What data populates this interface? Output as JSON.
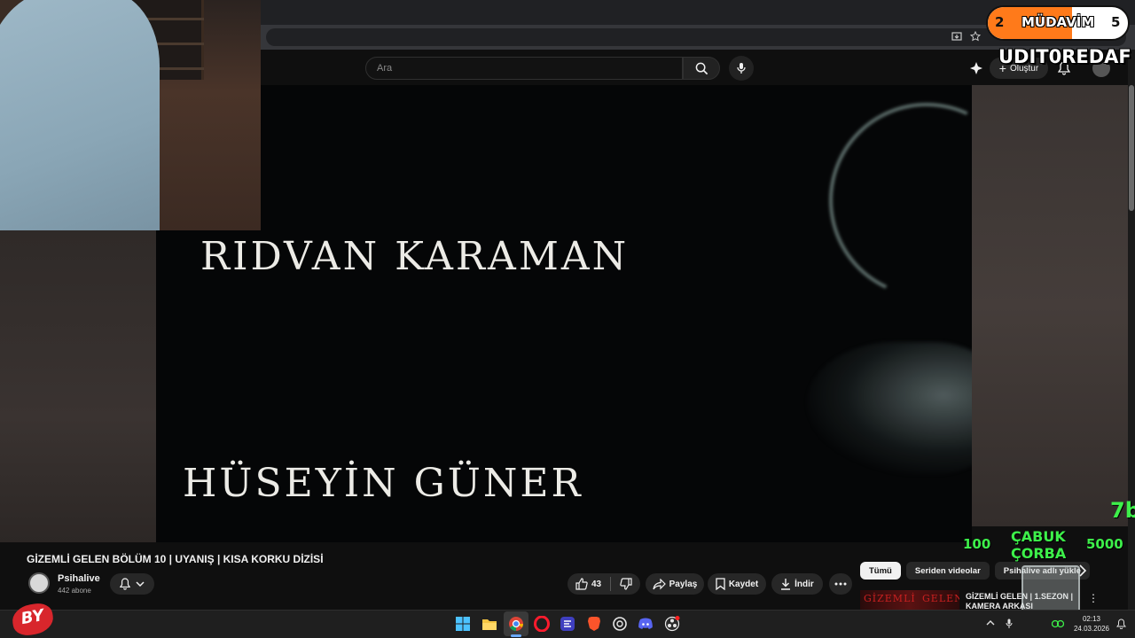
{
  "youtube": {
    "search_placeholder": "Ara",
    "create_label": "Oluştur"
  },
  "video": {
    "credit_line_1": "RIDVAN KARAMAN",
    "credit_line_2": "HÜSEYİN GÜNER"
  },
  "overlay": {
    "mudavim_left": "2",
    "mudavim_title": "MÜDAVİM",
    "mudavim_right": "5",
    "mudavim_progress": 0.6,
    "username": "UDIT0REDAF",
    "green_top": "7b",
    "soup_left": "100",
    "soup_label_1": "ÇABUK",
    "soup_label_2": "ÇORBA",
    "soup_right": "5000",
    "logo_text": "BY",
    "colors": {
      "accent_orange": "#ff7a1a",
      "overlay_green": "#3df04a"
    }
  },
  "watch": {
    "title": "GİZEMLİ GELEN BÖLÜM 10 | UYANIŞ | KISA KORKU DİZİSİ",
    "channel_name": "Psihalive",
    "subscribers": "442 abone",
    "like_count": "43",
    "share_label": "Paylaş",
    "save_label": "Kaydet",
    "download_label": "İndir"
  },
  "recommendations": {
    "chips": [
      "Tümü",
      "Seriden videolar",
      "Psihalive adlı yükle"
    ],
    "first_item_title": "GİZEMLİ GELEN | 1.SEZON | KAMERA ARKASI",
    "first_item_thumb_text": [
      "GİZEMLİ",
      "GELEN"
    ]
  },
  "taskbar": {
    "time": "02:13",
    "date": "24.03.2026",
    "icons": [
      "windows-start-icon",
      "file-explorer-icon",
      "chrome-icon",
      "opera-icon",
      "app-icon",
      "brave-icon",
      "chatgpt-icon",
      "discord-icon",
      "obs-icon"
    ]
  }
}
